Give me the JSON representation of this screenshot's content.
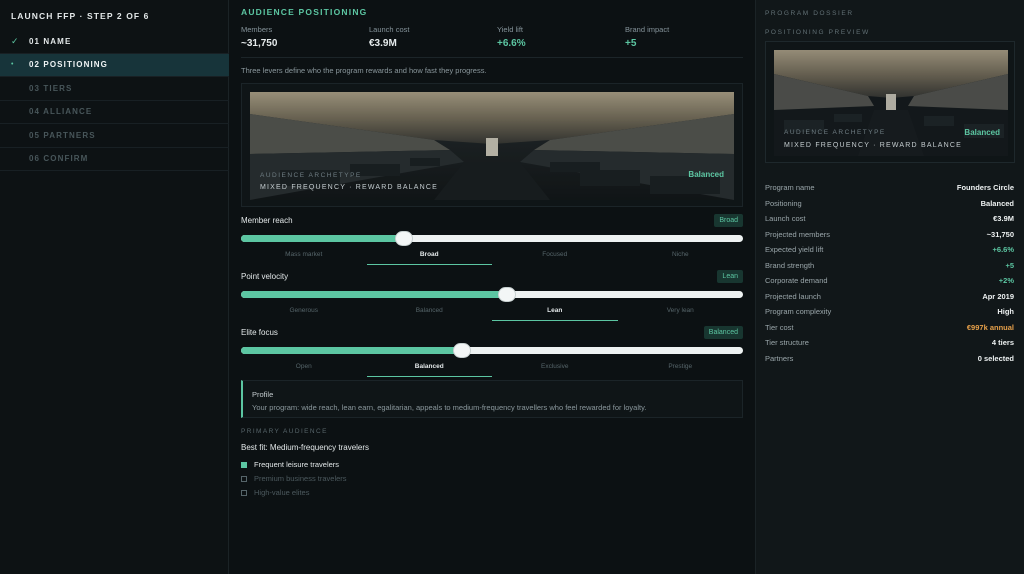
{
  "wizard": {
    "title": "LAUNCH FFP · STEP 2 OF 6",
    "steps": [
      {
        "label": "01 NAME",
        "state": "done",
        "mark": "✓"
      },
      {
        "label": "02 POSITIONING",
        "state": "active",
        "mark": "•"
      },
      {
        "label": "03 TIERS",
        "state": "pending",
        "mark": ""
      },
      {
        "label": "04 ALLIANCE",
        "state": "pending",
        "mark": ""
      },
      {
        "label": "05 PARTNERS",
        "state": "pending",
        "mark": ""
      },
      {
        "label": "06 CONFIRM",
        "state": "pending",
        "mark": ""
      }
    ]
  },
  "main": {
    "section_title": "AUDIENCE POSITIONING",
    "stats": [
      {
        "label": "Members",
        "value": "~31,750"
      },
      {
        "label": "Launch cost",
        "value": "€3.9M"
      },
      {
        "label": "Yield lift",
        "value": "+6.6%"
      },
      {
        "label": "Brand impact",
        "value": "+5"
      }
    ],
    "intro": "Three levers define who the program rewards and how fast they progress.",
    "hero": {
      "archetype_label": "AUDIENCE ARCHETYPE",
      "archetype_value": "MIXED FREQUENCY · REWARD BALANCE",
      "badge": "Balanced"
    },
    "levers": [
      {
        "name": "Member reach",
        "pill": "Broad",
        "value_pct": 32.5,
        "options": [
          "Mass market",
          "Broad",
          "Focused",
          "Niche"
        ],
        "selected": 1
      },
      {
        "name": "Point velocity",
        "pill": "Lean",
        "value_pct": 53,
        "options": [
          "Generous",
          "Balanced",
          "Lean",
          "Very lean"
        ],
        "selected": 2
      },
      {
        "name": "Elite focus",
        "pill": "Balanced",
        "value_pct": 44,
        "options": [
          "Open",
          "Balanced",
          "Exclusive",
          "Prestige"
        ],
        "selected": 1
      }
    ],
    "profile": {
      "title": "Profile",
      "text": "Your program: wide reach, lean earn, egalitarian, appeals to medium-frequency travellers who feel rewarded for loyalty."
    },
    "primary_audience": {
      "title": "PRIMARY AUDIENCE",
      "best_fit": "Best fit: Medium-frequency travelers",
      "items": [
        {
          "label": "Frequent leisure travelers",
          "checked": true
        },
        {
          "label": "Premium business travelers",
          "checked": false
        },
        {
          "label": "High-value elites",
          "checked": false
        }
      ]
    }
  },
  "dossier": {
    "title": "PROGRAM DOSSIER",
    "preview_title": "POSITIONING PREVIEW",
    "preview": {
      "archetype_label": "AUDIENCE ARCHETYPE",
      "archetype_value": "MIXED FREQUENCY · REWARD BALANCE",
      "badge": "Balanced"
    },
    "rows": [
      {
        "key": "Program name",
        "value": "Founders Circle",
        "tone": ""
      },
      {
        "key": "Positioning",
        "value": "Balanced",
        "tone": ""
      },
      {
        "key": "Launch cost",
        "value": "€3.9M",
        "tone": ""
      },
      {
        "key": "Projected members",
        "value": "~31,750",
        "tone": ""
      },
      {
        "key": "Expected yield lift",
        "value": "+6.6%",
        "tone": "green"
      },
      {
        "key": "Brand strength",
        "value": "+5",
        "tone": "green"
      },
      {
        "key": "Corporate demand",
        "value": "+2%",
        "tone": "green"
      },
      {
        "key": "Projected launch",
        "value": "Apr 2019",
        "tone": ""
      },
      {
        "key": "Program complexity",
        "value": "High",
        "tone": ""
      },
      {
        "key": "Tier cost",
        "value": "€997k annual",
        "tone": "orange"
      },
      {
        "key": "Tier structure",
        "value": "4 tiers",
        "tone": ""
      },
      {
        "key": "Partners",
        "value": "0 selected",
        "tone": ""
      }
    ]
  },
  "colors": {
    "accent": "#5cc6a2",
    "warning": "#e6a04a",
    "background": "#0c1113"
  }
}
